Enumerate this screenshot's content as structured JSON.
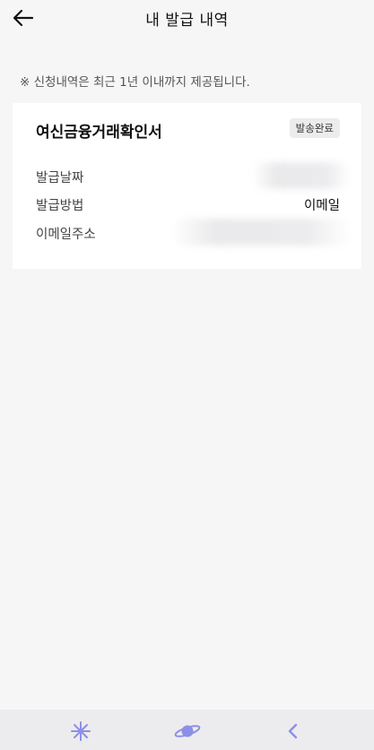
{
  "header": {
    "title": "내 발급 내역",
    "back_icon": "arrow-left-icon"
  },
  "notice": "※ 신청내역은 최근 1년 이내까지 제공됩니다.",
  "card": {
    "doc_title": "여신금융거래확인서",
    "status": "발송완료",
    "rows": [
      {
        "label": "발급날짜",
        "value": ""
      },
      {
        "label": "발급방법",
        "value": "이메일"
      },
      {
        "label": "이메일주소",
        "value": ""
      }
    ]
  },
  "bottom_nav": {
    "items": [
      {
        "icon": "sparkle-icon",
        "color": "#8d8fe6"
      },
      {
        "icon": "planet-icon",
        "color": "#8d8fe6"
      },
      {
        "icon": "chevron-left-icon",
        "color": "#8d8fe6"
      }
    ]
  }
}
